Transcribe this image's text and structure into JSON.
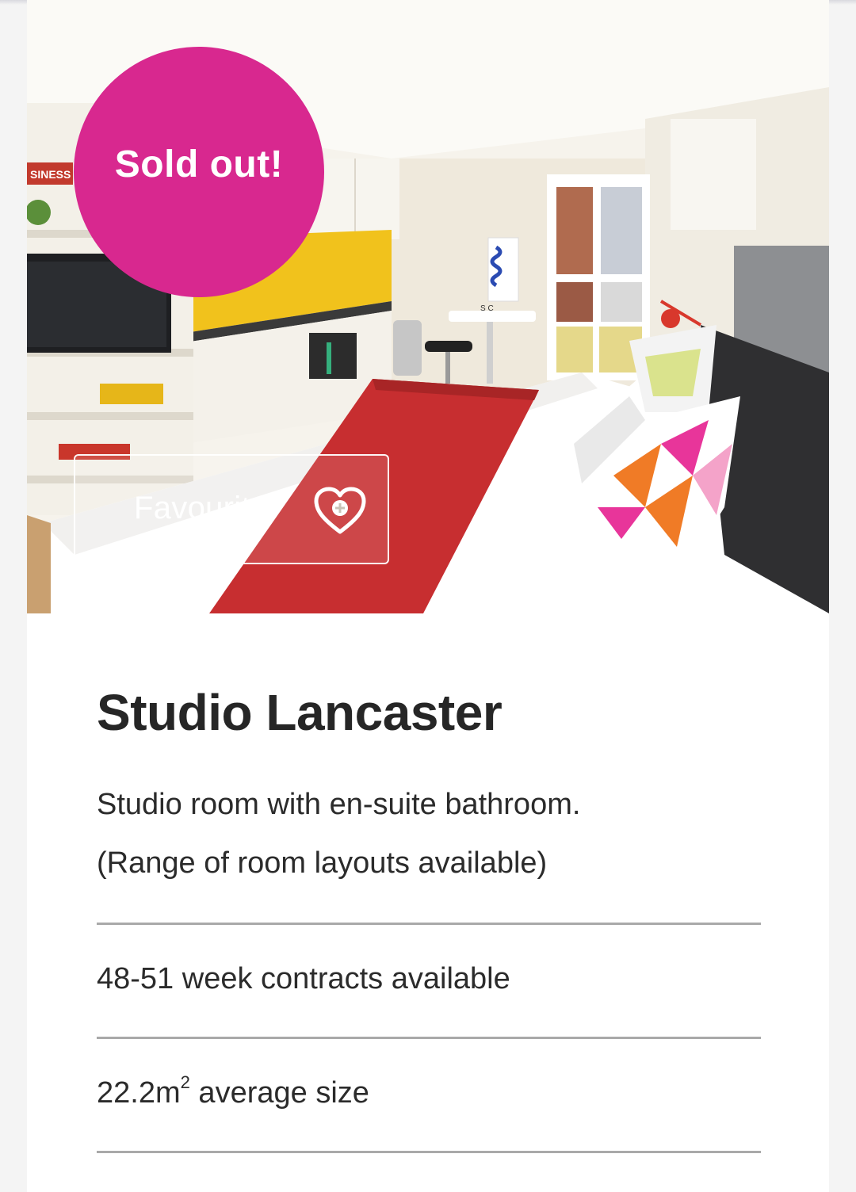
{
  "room": {
    "badge": "Sold out!",
    "favourite_label": "Favourite",
    "title": "Studio Lancaster",
    "description_line1": "Studio room with en-suite bathroom.",
    "description_line2": "(Range of room layouts available)",
    "features": {
      "contracts": "48-51 week contracts available",
      "size_value": "22.2m",
      "size_superscript": "2",
      "size_suffix": " average size"
    }
  },
  "photo": {
    "sign_text": "SINESS",
    "counter_labels": "S C"
  },
  "colors": {
    "badge": "#d8288f",
    "title_text": "#262626",
    "body_text": "#2b2b2b",
    "divider": "#a9a9a9"
  },
  "icons": {
    "favourite": "heart-plus-icon"
  }
}
